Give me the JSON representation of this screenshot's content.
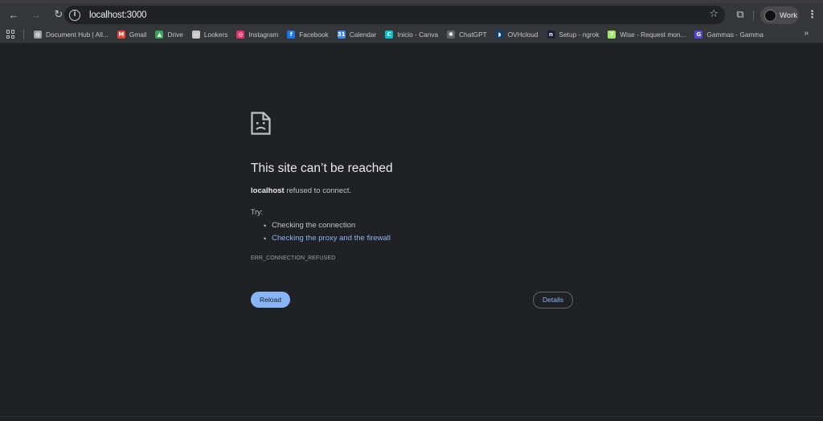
{
  "browser": {
    "url": "localhost:3000",
    "profile_label": "Work"
  },
  "bookmarks": [
    {
      "label": "Document Hub | All...",
      "icon": "globe-icon",
      "color": "#9aa0a6",
      "glyph": "◍"
    },
    {
      "label": "Gmail",
      "icon": "gmail-icon",
      "color": "#ea4335",
      "glyph": "M"
    },
    {
      "label": "Drive",
      "icon": "drive-icon",
      "color": "#34a853",
      "glyph": "▲"
    },
    {
      "label": "Lookers",
      "icon": "folder-icon",
      "color": "#c4c7c5",
      "glyph": "▭"
    },
    {
      "label": "Instagram",
      "icon": "instagram-icon",
      "color": "#e1306c",
      "glyph": "◎"
    },
    {
      "label": "Facebook",
      "icon": "facebook-icon",
      "color": "#1877f2",
      "glyph": "f"
    },
    {
      "label": "Calendar",
      "icon": "calendar-icon",
      "color": "#4285f4",
      "glyph": "31"
    },
    {
      "label": "Inicio - Canva",
      "icon": "canva-icon",
      "color": "#00c4cc",
      "glyph": "C"
    },
    {
      "label": "ChatGPT",
      "icon": "chatgpt-icon",
      "color": "#5f6368",
      "glyph": "✺"
    },
    {
      "label": "OVHcloud",
      "icon": "ovhcloud-icon",
      "color": "#123f6d",
      "glyph": "◗"
    },
    {
      "label": "Setup - ngrok",
      "icon": "ngrok-icon",
      "color": "#1f1e37",
      "glyph": "n"
    },
    {
      "label": "Wise - Request mon...",
      "icon": "wise-icon",
      "color": "#9fe870",
      "glyph": "7"
    },
    {
      "label": "Gammas - Gamma",
      "icon": "gamma-icon",
      "color": "#4f46e5",
      "glyph": "G"
    }
  ],
  "error": {
    "title": "This site can’t be reached",
    "host": "localhost",
    "message": " refused to connect.",
    "try_label": "Try:",
    "suggestions": [
      {
        "text": "Checking the connection",
        "link": false
      },
      {
        "text": "Checking the proxy and the firewall",
        "link": true
      }
    ],
    "code": "ERR_CONNECTION_REFUSED",
    "reload_label": "Reload",
    "details_label": "Details"
  },
  "colors": {
    "page_bg": "#202124",
    "toolbar_bg": "#35363a",
    "accent": "#8ab4f8"
  }
}
